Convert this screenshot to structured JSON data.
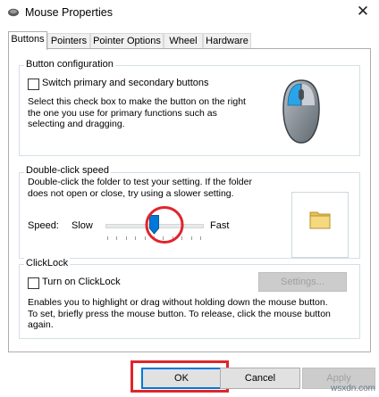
{
  "window": {
    "title": "Mouse Properties",
    "close_glyph": "✕"
  },
  "tabs": [
    {
      "label": "Buttons",
      "active": true
    },
    {
      "label": "Pointers",
      "active": false
    },
    {
      "label": "Pointer Options",
      "active": false
    },
    {
      "label": "Wheel",
      "active": false
    },
    {
      "label": "Hardware",
      "active": false
    }
  ],
  "button_config": {
    "legend": "Button configuration",
    "checkbox_label": "Switch primary and secondary buttons",
    "checked": false,
    "description_lines": [
      "Select this check box to make the button on the right",
      "the one you use for primary functions such as",
      "selecting and dragging."
    ]
  },
  "double_click": {
    "legend": "Double-click speed",
    "description_lines": [
      "Double-click the folder to test your setting. If the folder",
      "does not open or close, try using a slower setting."
    ],
    "speed_label": "Speed:",
    "slow_label": "Slow",
    "fast_label": "Fast",
    "slider_value_fraction": 0.5
  },
  "clicklock": {
    "legend": "ClickLock",
    "checkbox_label": "Turn on ClickLock",
    "checked": false,
    "settings_button": "Settings...",
    "description_lines": [
      "Enables you to highlight or drag without holding down the mouse button.",
      "To set, briefly press the mouse button. To release, click the mouse button",
      "again."
    ]
  },
  "footer": {
    "ok": "OK",
    "cancel": "Cancel",
    "apply": "Apply"
  },
  "watermark": "wsxdn.com",
  "colors": {
    "annotation_red": "#e0252b",
    "slider_blue": "#0078d7",
    "mouse_highlight": "#2aa3e8"
  }
}
